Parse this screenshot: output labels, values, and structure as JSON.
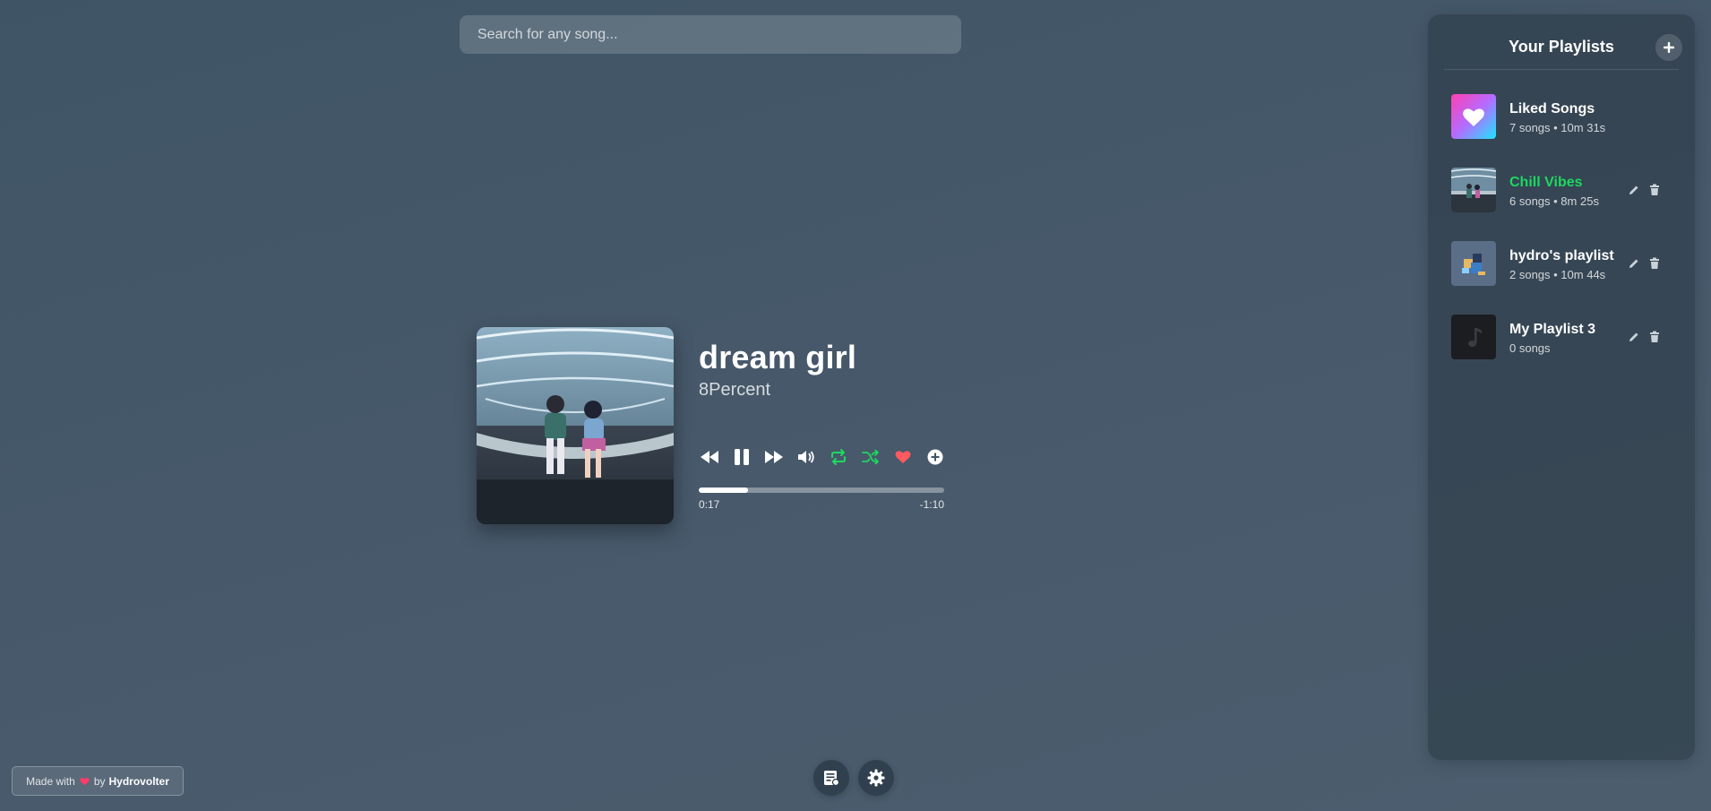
{
  "search": {
    "placeholder": "Search for any song..."
  },
  "player": {
    "title": "dream girl",
    "artist": "8Percent",
    "current_time": "0:17",
    "remaining_time": "-1:10",
    "progress_fraction": 0.2,
    "repeat_on": true,
    "shuffle_on": true,
    "liked": true,
    "accent_color": "#1ed760",
    "heart_color": "#ff5a5f",
    "controls": [
      "rewind-icon",
      "pause-icon",
      "fast-forward-icon",
      "volume-icon",
      "repeat-icon",
      "shuffle-icon",
      "heart-icon",
      "add-circle-icon"
    ]
  },
  "sidebar": {
    "title": "Your Playlists",
    "items": [
      {
        "name": "Liked Songs",
        "meta": "7 songs • 10m 31s",
        "active": false,
        "editable": false
      },
      {
        "name": "Chill Vibes",
        "meta": "6 songs • 8m 25s",
        "active": true,
        "editable": true
      },
      {
        "name": "hydro's playlist",
        "meta": "2 songs • 10m 44s",
        "active": false,
        "editable": true
      },
      {
        "name": "My Playlist 3",
        "meta": "0 songs",
        "active": false,
        "editable": true
      }
    ]
  },
  "footer": {
    "made_with_prefix": "Made with",
    "made_with_by": "by",
    "author": "Hydrovolter"
  }
}
